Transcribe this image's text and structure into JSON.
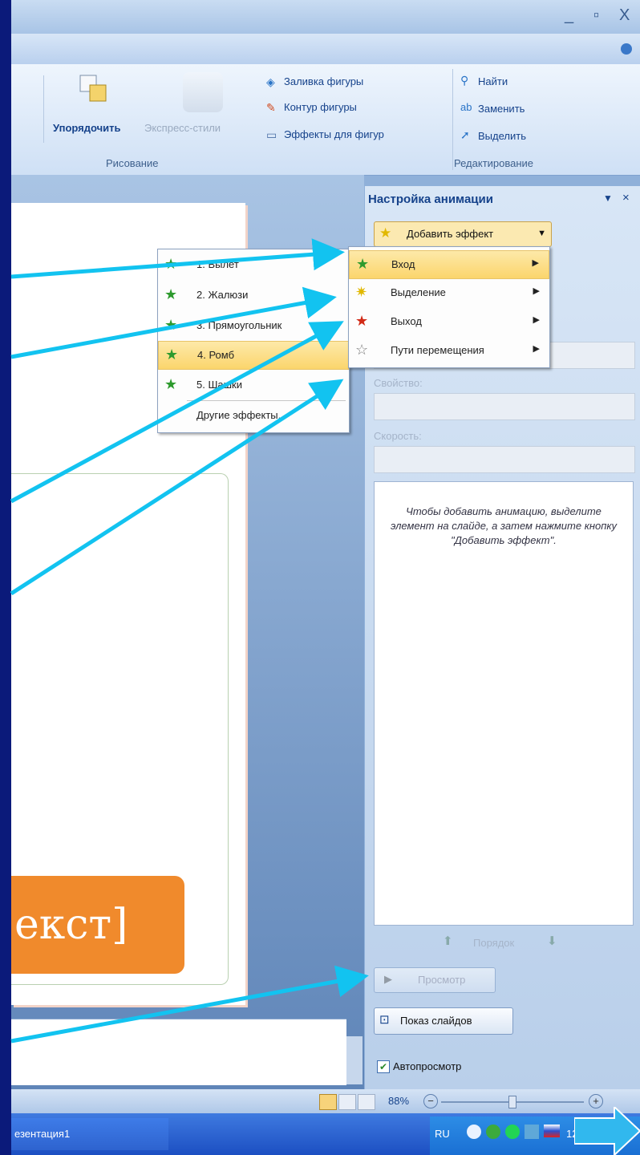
{
  "titlebar": {
    "minimize": "_",
    "restore": "▫",
    "close": "X"
  },
  "ribbon": {
    "arrange": "Упорядочить",
    "quick_styles": "Экспресс-стили",
    "shape_fill": "Заливка фигуры",
    "shape_outline": "Контур фигуры",
    "shape_effects": "Эффекты для фигур",
    "find": "Найти",
    "replace": "Заменить",
    "select": "Выделить",
    "group_drawing": "Рисование",
    "group_editing": "Редактирование"
  },
  "slide": {
    "text": "екст]"
  },
  "pane": {
    "title": "Настройка анимации",
    "add_effect": "Добавить эффект",
    "property_label": "Свойство:",
    "speed_label": "Скорость:",
    "hint": "Чтобы добавить анимацию, выделите элемент на слайде, а затем нажмите кнопку \"Добавить эффект\".",
    "order_label": "Порядок",
    "preview": "Просмотр",
    "slideshow": "Показ слайдов",
    "autopreview": "Автопросмотр"
  },
  "menu_main": {
    "items": [
      {
        "label": "Вход",
        "icon": "entrance-star-icon"
      },
      {
        "label": "Выделение",
        "icon": "emphasis-star-icon"
      },
      {
        "label": "Выход",
        "icon": "exit-star-icon"
      },
      {
        "label": "Пути перемещения",
        "icon": "motion-path-star-icon"
      }
    ]
  },
  "menu_sub": {
    "items": [
      {
        "label": "1. Вылет"
      },
      {
        "label": "2. Жалюзи"
      },
      {
        "label": "3. Прямоугольник"
      },
      {
        "label": "4. Ромб"
      },
      {
        "label": "5. Шашки"
      }
    ],
    "more": "Другие эффекты..."
  },
  "status": {
    "zoom": "88%"
  },
  "taskbar": {
    "window": "езентация1",
    "lang": "RU",
    "clock": "12"
  },
  "colors": {
    "arrow": "#12c3f0",
    "orange": "#f08a2c",
    "background": "#0b1a7a"
  }
}
